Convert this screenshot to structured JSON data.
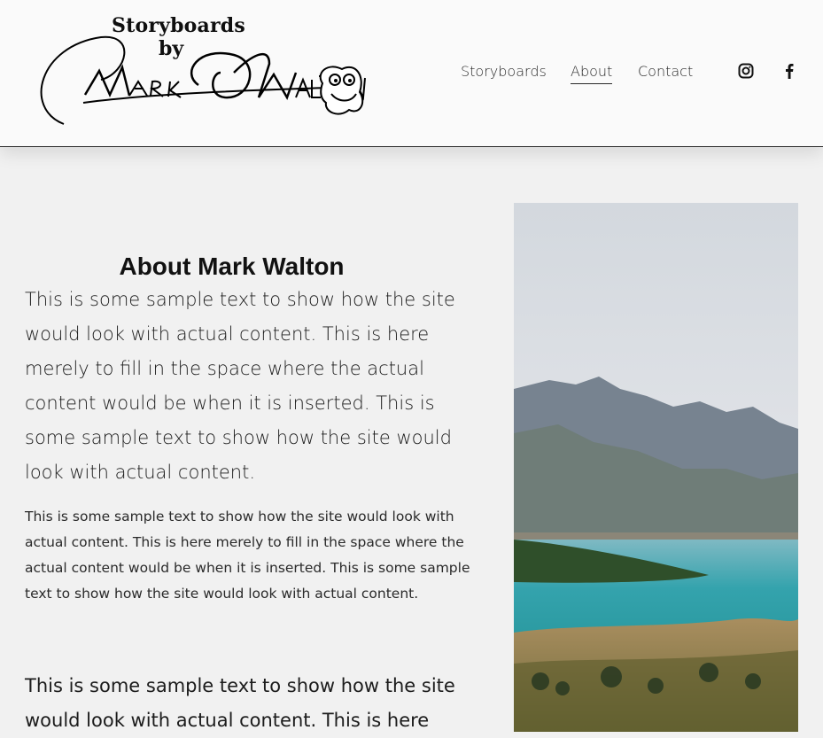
{
  "header": {
    "logo": {
      "line1": "Storyboards",
      "line2": "by",
      "signature_text": "Mark Walton"
    },
    "nav": [
      {
        "label": "Storyboards",
        "active": false
      },
      {
        "label": "About",
        "active": true
      },
      {
        "label": "Contact",
        "active": false
      }
    ],
    "social": [
      "instagram-icon",
      "facebook-icon"
    ]
  },
  "main": {
    "title": "About Mark Walton",
    "lead": "This is some sample text to show how the site would look with actual content. This is here merely to fill in the space where the actual content would be when it is inserted. This is some sample text to show how the site would look with actual content.",
    "small": "This is some sample text to show how the site would look with actual content. This is here merely to fill in the space where the actual content would be when it is inserted. This is some sample text to show how the site would look with actual content.",
    "lead2": "This is some sample text to show how the site would look with actual content. This is here"
  },
  "colors": {
    "page_bg": "#f1f1f1",
    "header_bg": "#fafafa",
    "text": "#1e1e1e",
    "lake": "#3fa9b4"
  }
}
